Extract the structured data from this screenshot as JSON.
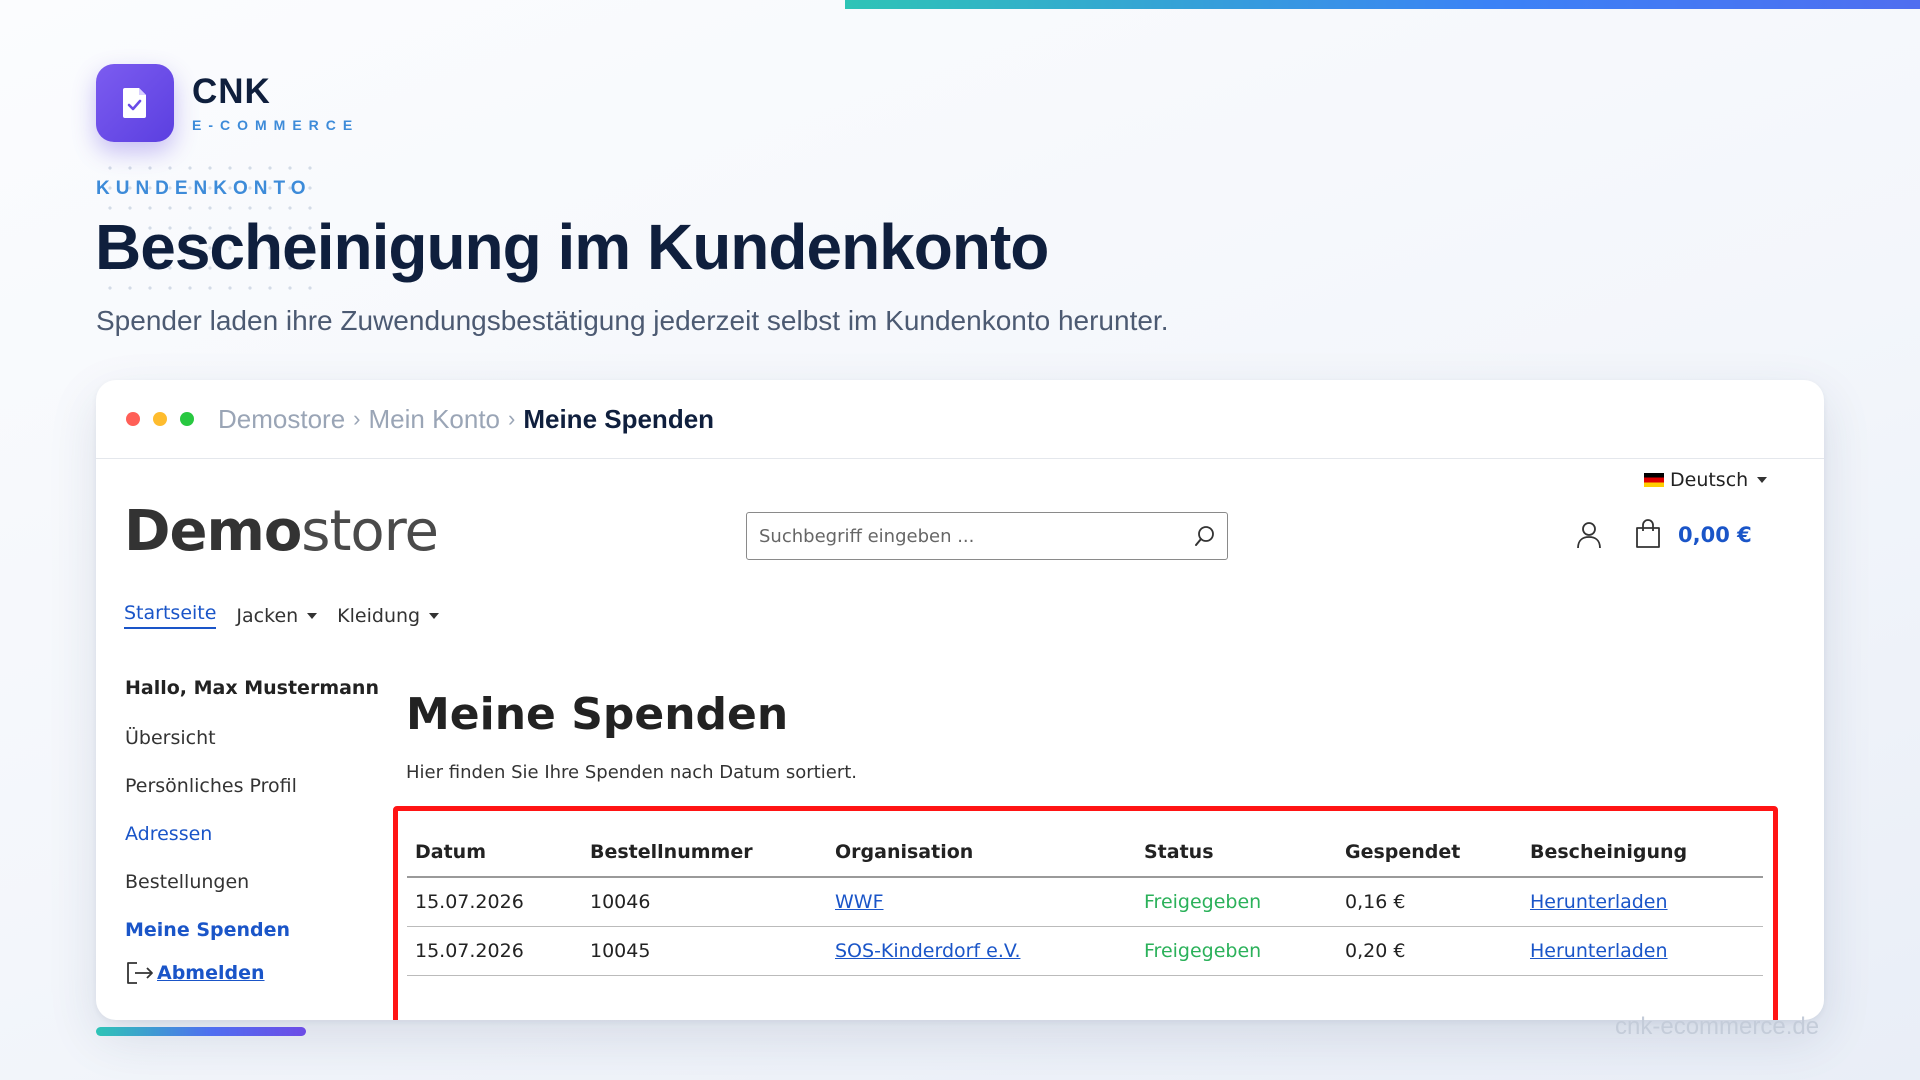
{
  "brand": {
    "name": "CNK",
    "sub": "E-COMMERCE"
  },
  "hero": {
    "eyebrow": "KUNDENKONTO",
    "title": "Bescheinigung im Kundenkonto",
    "subtitle": "Spender laden ihre Zuwendungsbestätigung jederzeit selbst im Kundenkonto herunter."
  },
  "watermark": "cnk-ecommerce.de",
  "browser": {
    "breadcrumbs": [
      "Demostore",
      "Mein Konto",
      "Meine Spenden"
    ],
    "separator": "›"
  },
  "store": {
    "logo_bold": "Demo",
    "logo_light": "store",
    "language": "Deutsch",
    "search_placeholder": "Suchbegriff eingeben ...",
    "cart_total": "0,00 €",
    "nav": [
      {
        "label": "Startseite",
        "active": true
      },
      {
        "label": "Jacken",
        "dropdown": true
      },
      {
        "label": "Kleidung",
        "dropdown": true
      }
    ]
  },
  "sidebar": {
    "greeting": "Hallo, Max Mustermann",
    "items": [
      "Übersicht",
      "Persönliches Profil",
      "Adressen",
      "Bestellungen",
      "Meine Spenden"
    ],
    "logout": "Abmelden"
  },
  "main": {
    "title": "Meine Spenden",
    "intro": "Hier finden Sie Ihre Spenden nach Datum sortiert.",
    "table": {
      "headers": [
        "Datum",
        "Bestellnummer",
        "Organisation",
        "Status",
        "Gespendet",
        "Bescheinigung"
      ],
      "rows": [
        [
          "15.07.2026",
          "10046",
          "WWF",
          "Freigegeben",
          "0,16 €",
          "Herunterladen"
        ],
        [
          "15.07.2026",
          "10045",
          "SOS-Kinderdorf e.V.",
          "Freigegeben",
          "0,20 €",
          "Herunterladen"
        ]
      ]
    }
  },
  "colors": {
    "accent_blue": "#1a55c8",
    "status_green": "#2bb15a",
    "highlight_red": "#ff1414",
    "brand_purple": "#6a4ce8"
  }
}
